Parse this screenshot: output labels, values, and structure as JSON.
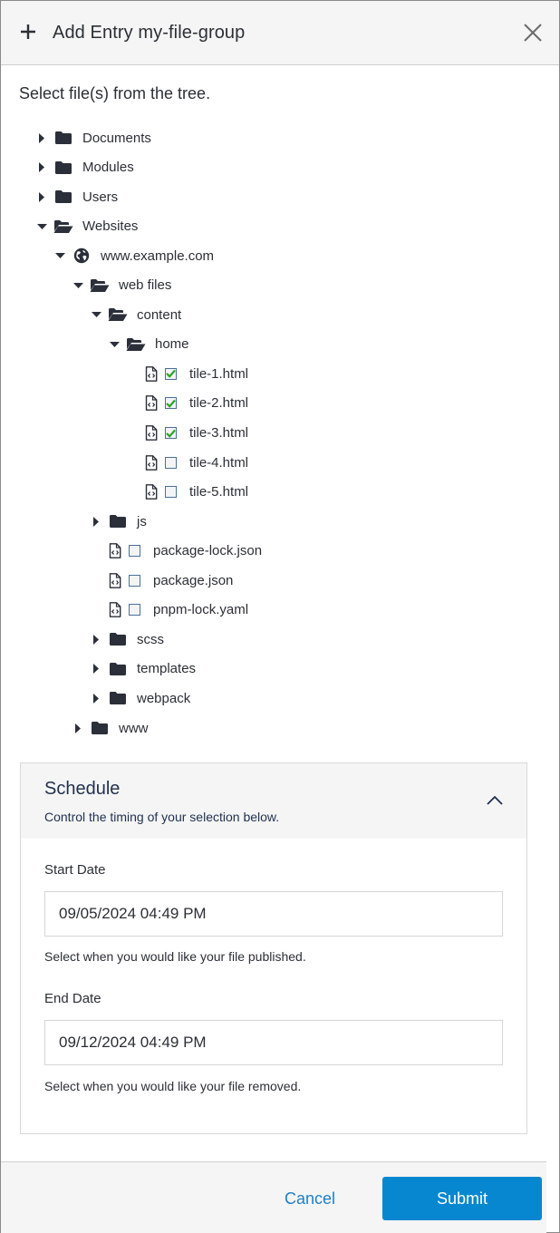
{
  "dialog": {
    "title": "Add Entry my-file-group",
    "header_icon": "plus-icon",
    "close_icon": "close-icon"
  },
  "intro": "Select file(s) from the tree.",
  "tree": [
    {
      "label": "Documents",
      "type": "folder",
      "depth": 0,
      "expanded": false
    },
    {
      "label": "Modules",
      "type": "folder",
      "depth": 0,
      "expanded": false
    },
    {
      "label": "Users",
      "type": "folder",
      "depth": 0,
      "expanded": false
    },
    {
      "label": "Websites",
      "type": "folder",
      "depth": 0,
      "expanded": true
    },
    {
      "label": "www.example.com",
      "type": "site",
      "depth": 1,
      "expanded": true
    },
    {
      "label": "web files",
      "type": "folder",
      "depth": 2,
      "expanded": true
    },
    {
      "label": "content",
      "type": "folder",
      "depth": 3,
      "expanded": true
    },
    {
      "label": "home",
      "type": "folder",
      "depth": 4,
      "expanded": true
    },
    {
      "label": "tile-1.html",
      "type": "file",
      "depth": 5,
      "checked": true
    },
    {
      "label": "tile-2.html",
      "type": "file",
      "depth": 5,
      "checked": true
    },
    {
      "label": "tile-3.html",
      "type": "file",
      "depth": 5,
      "checked": true
    },
    {
      "label": "tile-4.html",
      "type": "file",
      "depth": 5,
      "checked": false
    },
    {
      "label": "tile-5.html",
      "type": "file",
      "depth": 5,
      "checked": false
    },
    {
      "label": "js",
      "type": "folder",
      "depth": 3,
      "expanded": false
    },
    {
      "label": "package-lock.json",
      "type": "file",
      "depth": 4,
      "checked": false
    },
    {
      "label": "package.json",
      "type": "file",
      "depth": 4,
      "checked": false
    },
    {
      "label": "pnpm-lock.yaml",
      "type": "file",
      "depth": 4,
      "checked": false
    },
    {
      "label": "scss",
      "type": "folder",
      "depth": 3,
      "expanded": false
    },
    {
      "label": "templates",
      "type": "folder",
      "depth": 3,
      "expanded": false
    },
    {
      "label": "webpack",
      "type": "folder",
      "depth": 3,
      "expanded": false
    },
    {
      "label": "www",
      "type": "folder",
      "depth": 2,
      "expanded": false
    }
  ],
  "schedule": {
    "title": "Schedule",
    "subtitle": "Control the timing of your selection below.",
    "expanded": true,
    "start_date": {
      "label": "Start Date",
      "value": "09/05/2024 04:49 PM",
      "help": "Select when you would like your file published."
    },
    "end_date": {
      "label": "End Date",
      "value": "09/12/2024 04:49 PM",
      "help": "Select when you would like your file removed."
    }
  },
  "footer": {
    "cancel_label": "Cancel",
    "submit_label": "Submit"
  },
  "colors": {
    "primary": "#0787d0",
    "link": "#1e7fc8",
    "check": "#2aa52a",
    "icon_dark": "#2b2f3a"
  }
}
